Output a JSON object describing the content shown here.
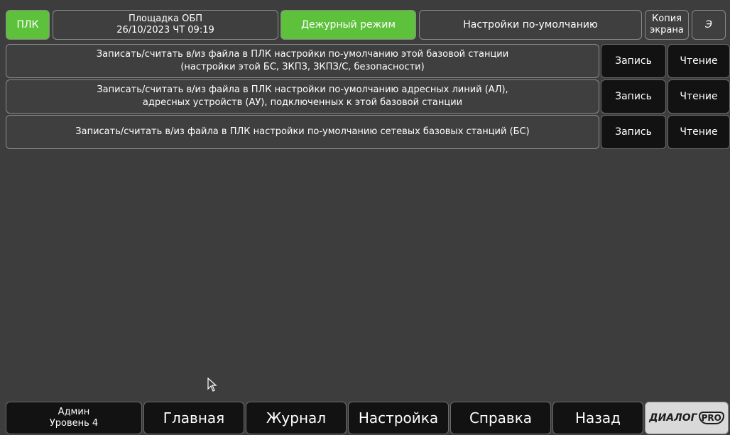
{
  "header": {
    "plc_label": "ПЛК",
    "site_name": "Площадка ОБП",
    "datetime": "26/10/2023 ЧТ 09:19",
    "mode": "Дежурный режим",
    "page_title": "Настройки по-умолчанию",
    "screen_copy_line1": "Копия",
    "screen_copy_line2": "экрана",
    "energy_label": "Э"
  },
  "rows": [
    {
      "line1": "Записать/считать в/из файла в ПЛК настройки по-умолчанию этой базовой станции",
      "line2": "(настройки этой БС, ЗКПЗ, ЗКПЗ/С, безопасности)",
      "write_label": "Запись",
      "read_label": "Чтение"
    },
    {
      "line1": "Записать/считать в/из файла в ПЛК настройки по-умолчанию адресных линий (АЛ),",
      "line2": "адресных устройств (АУ), подключенных к этой базовой станции",
      "write_label": "Запись",
      "read_label": "Чтение"
    },
    {
      "line1": "Записать/считать в/из файла в ПЛК настройки по-умолчанию сетевых базовых станций (БС)",
      "line2": "",
      "write_label": "Запись",
      "read_label": "Чтение"
    }
  ],
  "footer": {
    "user_name": "Админ",
    "user_level": "Уровень 4",
    "nav": [
      "Главная",
      "Журнал",
      "Настройка",
      "Справка",
      "Назад"
    ],
    "logo_text": "ДИАЛОГ",
    "logo_pro": "PRO"
  },
  "colors": {
    "background": "#3d3d3d",
    "accent_green": "#5dc13b",
    "button_dark": "#121212"
  }
}
